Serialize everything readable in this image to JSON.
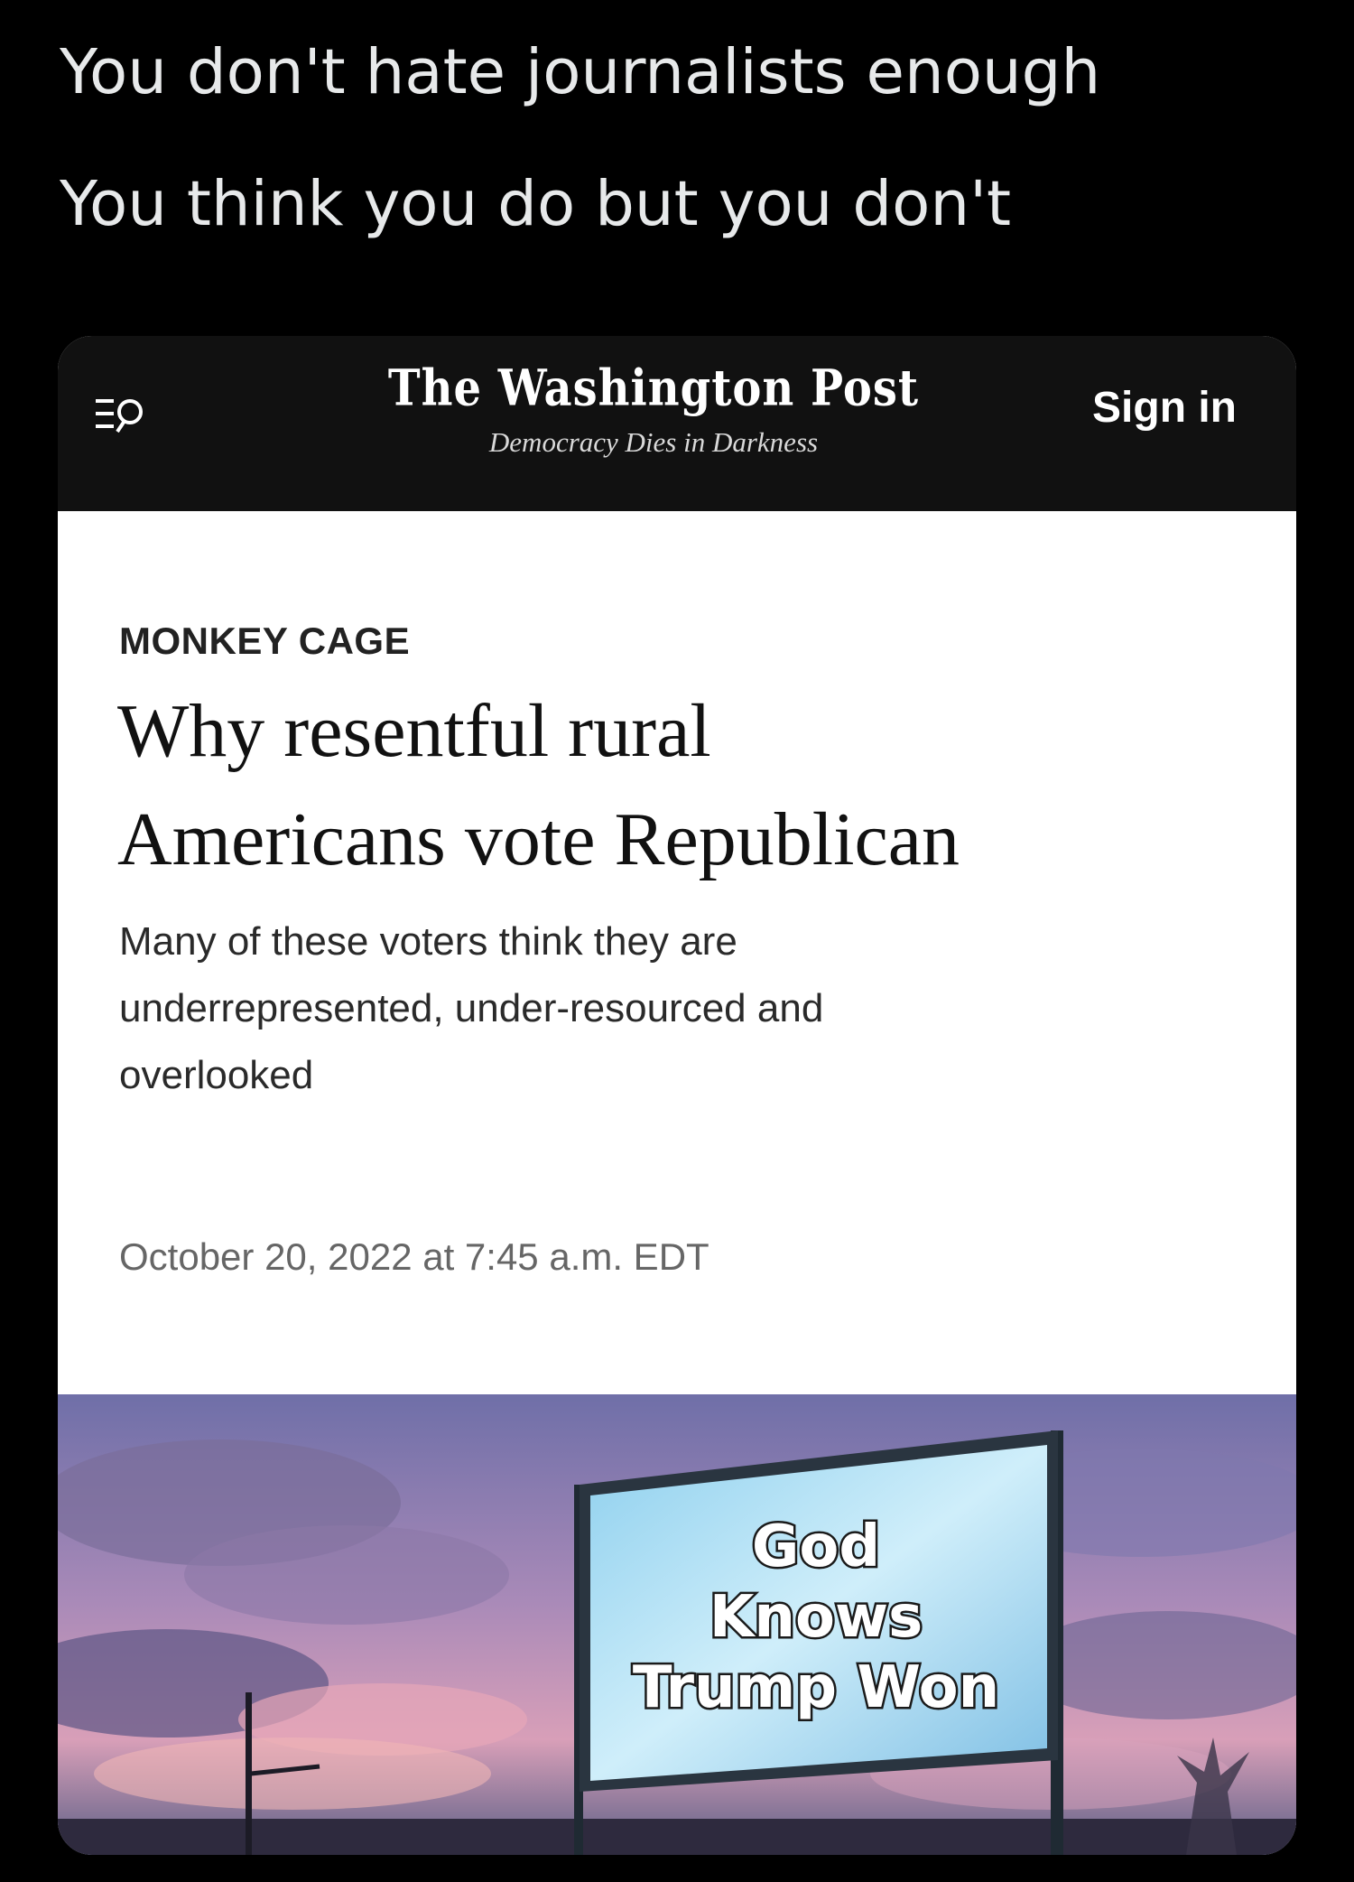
{
  "tweet": {
    "line1": "You don't hate journalists enough",
    "line2": "You think you do but you don't"
  },
  "header": {
    "logo": "The Washington Post",
    "tagline": "Democracy Dies in Darkness",
    "sign_in": "Sign in",
    "menu_icon": "menu-search-icon"
  },
  "article": {
    "kicker": "MONKEY CAGE",
    "headline_lines": [
      "Why resentful rural",
      "Americans vote Republican"
    ],
    "dek_lines": [
      "Many of these voters think they are",
      "underrepresented, under-resourced and",
      "overlooked"
    ],
    "dateline": "October 20, 2022 at 7:45 a.m. EDT"
  },
  "photo": {
    "sign_lines": [
      "God",
      "Knows",
      "Trump Won"
    ]
  },
  "colors": {
    "background": "#000000",
    "header_bg": "#111111",
    "card_bg": "#ffffff"
  }
}
